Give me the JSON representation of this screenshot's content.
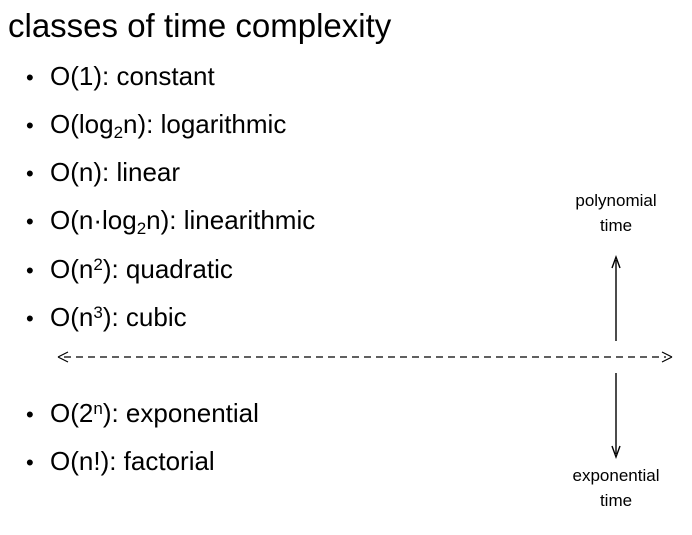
{
  "title": "classes of time complexity",
  "items": [
    {
      "pre": "O(1): constant"
    },
    {
      "pre": "O(log",
      "sub": "2",
      "post": "n): logarithmic"
    },
    {
      "pre": "O(n): linear"
    },
    {
      "pre": "O(n·log",
      "sub": "2",
      "post": "n): linearithmic"
    },
    {
      "pre": "O(n",
      "sup": "2",
      "post": "): quadratic"
    },
    {
      "pre": "O(n",
      "sup": "3",
      "post": "): cubic"
    },
    {
      "pre": "O(2",
      "sup": "n",
      "post": "): exponential"
    },
    {
      "pre": "O(n!): factorial"
    }
  ],
  "bullet_char": "•",
  "labels": {
    "polynomial": [
      "polynomial",
      "time"
    ],
    "exponential": [
      "exponential",
      "time"
    ]
  }
}
